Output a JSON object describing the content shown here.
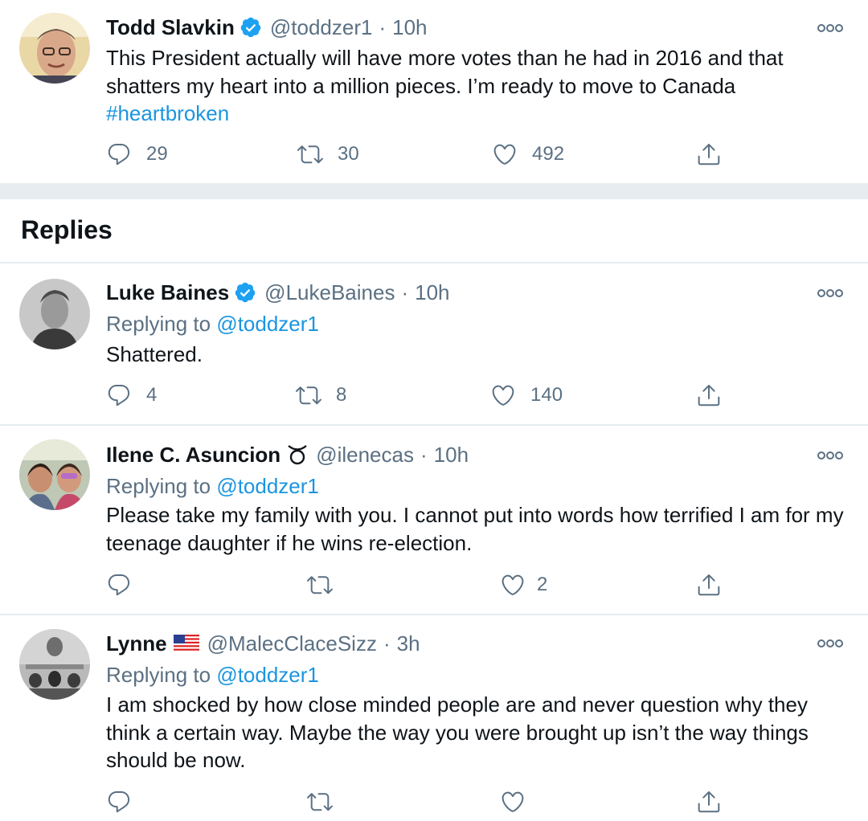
{
  "main_tweet": {
    "name": "Todd Slavkin",
    "handle": "@toddzer1",
    "time": "10h",
    "text_before": "This President actually will have more votes than he had in 2016 and that shatters my heart into a million pieces. I’m ready to move to Canada",
    "hashtag": "#heartbroken",
    "replies": "29",
    "retweets": "30",
    "likes": "492"
  },
  "section": {
    "title": "Replies"
  },
  "replies": [
    {
      "name": "Luke Baines",
      "handle": "@LukeBaines",
      "time": "10h",
      "replying_label": "Replying to",
      "replying_to": "@toddzer1",
      "text": "Shattered.",
      "replies": "4",
      "retweets": "8",
      "likes": "140"
    },
    {
      "name": "Ilene C. Asuncion",
      "name_emoji": "♉",
      "handle": "@ilenecas",
      "time": "10h",
      "replying_label": "Replying to",
      "replying_to": "@toddzer1",
      "text": "Please take my family with you.  I cannot put into words how terrified I am for my teenage daughter if he wins re-election.",
      "replies": "",
      "retweets": "",
      "likes": "2"
    },
    {
      "name": "Lynne",
      "name_emoji": "us-flag",
      "handle": "@MalecClaceSizz",
      "time": "3h",
      "replying_label": "Replying to",
      "replying_to": "@toddzer1",
      "text": "I am shocked by how close minded people are and never question why they think a certain way. Maybe the way you were brought up isn’t the way things should be now.",
      "replies": "",
      "retweets": "",
      "likes": ""
    }
  ],
  "separator": "·",
  "colors": {
    "link": "#1b95e0",
    "muted": "#5b7083",
    "divider": "#e6ecf0",
    "verified": "#1da1f2"
  },
  "icons": [
    "verified-badge-icon",
    "more-options-icon",
    "reply-icon",
    "retweet-icon",
    "like-icon",
    "share-icon"
  ]
}
